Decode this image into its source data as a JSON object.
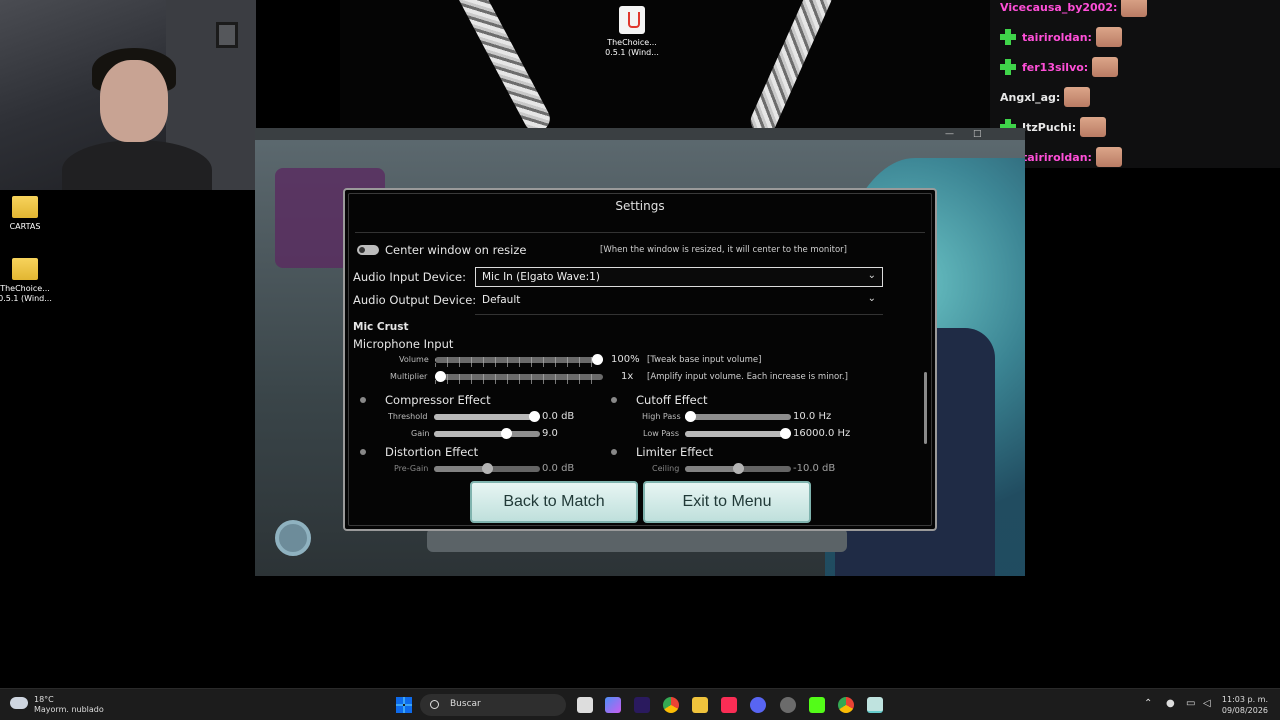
{
  "desktop": {
    "icons": [
      {
        "label": "CARTAS"
      },
      {
        "label": "TheChoice...\n0.5.1 (Wind..."
      },
      {
        "label": "TheChoice...\n0.5.1 (Wind..."
      }
    ]
  },
  "chat": {
    "messages": [
      {
        "user": "Vicecausa_by2002:",
        "color": "#ff4fd8",
        "badge": false
      },
      {
        "user": "tairiroldan:",
        "color": "#ff4fd8",
        "badge": true
      },
      {
        "user": "fer13silvo:",
        "color": "#ff4fd8",
        "badge": true
      },
      {
        "user": "Angxl_ag:",
        "color": "#e8e8e8",
        "badge": false
      },
      {
        "user": "ItzPuchi:",
        "color": "#e8e8e8",
        "badge": true
      },
      {
        "user": "tairiroldan:",
        "color": "#ff4fd8",
        "badge": true
      }
    ]
  },
  "settings": {
    "title": "Settings",
    "center_window": {
      "label": "Center window on resize",
      "hint": "[When the window is resized, it will center to the monitor]",
      "enabled": true
    },
    "audio_input": {
      "label": "Audio Input Device:",
      "value": "Mic In (Elgato Wave:1)"
    },
    "audio_output": {
      "label": "Audio Output Device:",
      "value": "Default"
    },
    "mic_crust": {
      "section": "Mic Crust",
      "subsection": "Microphone Input",
      "volume": {
        "label": "Volume",
        "value": "100%",
        "hint": "[Tweak base input volume]",
        "level": 1.0
      },
      "multiplier": {
        "label": "Multiplier",
        "value": "1x",
        "hint": "[Amplify input volume. Each increase is minor.]",
        "level": 0.0
      }
    },
    "compressor": {
      "title": "Compressor Effect",
      "threshold": {
        "label": "Threshold",
        "value": "0.0 dB",
        "level": 1.0
      },
      "gain": {
        "label": "Gain",
        "value": "9.0",
        "level": 0.7
      }
    },
    "cutoff": {
      "title": "Cutoff Effect",
      "high_pass": {
        "label": "High Pass",
        "value": "10.0 Hz",
        "level": 0.0
      },
      "low_pass": {
        "label": "Low Pass",
        "value": "16000.0 Hz",
        "level": 1.0
      }
    },
    "distortion": {
      "title": "Distortion Effect",
      "pre_gain": {
        "label": "Pre-Gain",
        "value": "0.0 dB",
        "level": 0.5
      }
    },
    "limiter": {
      "title": "Limiter Effect",
      "ceiling": {
        "label": "Ceiling",
        "value": "-10.0 dB",
        "level": 0.5
      }
    },
    "buttons": {
      "back": "Back to Match",
      "exit": "Exit to Menu"
    }
  },
  "taskbar": {
    "weather_temp": "18°C",
    "weather_desc": "Mayorm. nublado",
    "search_placeholder": "Buscar",
    "time": "11:03 p. m.",
    "date": "09/08/2026"
  },
  "colors": {
    "button_bg": "#cfe9e6",
    "accent_green": "#3fd44a",
    "chat_pink": "#ff4fd8"
  }
}
